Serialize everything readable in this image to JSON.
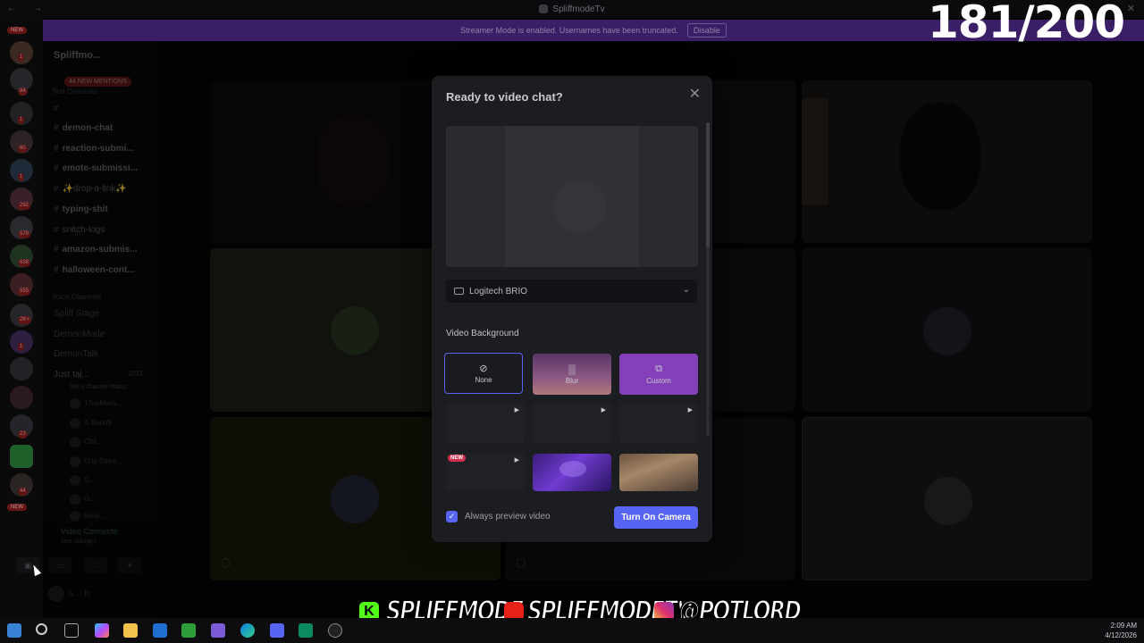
{
  "window": {
    "title": "SpliffmodeTv",
    "nav_glyph": "← →",
    "close_glyph": "✕"
  },
  "banner": {
    "text": "Streamer Mode is enabled. Usernames have been truncated.",
    "button": "Disable"
  },
  "counter": "181/200",
  "server_rail": {
    "new_top": "NEW",
    "new_bottom": "NEW",
    "badges": [
      "1",
      "94",
      "1",
      "60",
      "1",
      "292",
      "579",
      "638",
      "555",
      "2K+",
      "1",
      "23",
      "44"
    ]
  },
  "sidebar": {
    "server_name": "Spliffmo...",
    "mentions": "44 NEW MENTIONS",
    "text_category": "Text Channels",
    "channels": [
      "demon-chat",
      "reaction-submi...",
      "emote-submissi...",
      "✨drop-a-link✨",
      "typing-shit",
      "snitch-logs",
      "amazon-submis...",
      "halloween-cont..."
    ],
    "voice_category": "Voice Channels",
    "voice_channels": [
      "Spliff Stage",
      "DemonMode",
      "DemonTalk",
      "Just tal...",
      "Set a channel status"
    ],
    "voice_count": "2/33",
    "voice_users": [
      "1TooMany...",
      "A-Band$",
      "Chil...",
      "Crip Strea...",
      "G...",
      "G...",
      "boca..."
    ],
    "voice_panel": {
      "status": "Video Connecte",
      "sub": "Just talking / ..."
    },
    "user": {
      "name": "S...",
      "status": "In"
    }
  },
  "modal": {
    "title": "Ready to video chat?",
    "close_glyph": "✕",
    "camera": "Logitech BRIO",
    "background_heading": "Video Background",
    "options": [
      {
        "label": "None",
        "icon": "⊘"
      },
      {
        "label": "Blur",
        "icon": "▒"
      },
      {
        "label": "Custom",
        "icon": "⧉"
      }
    ],
    "new_tag": "NEW",
    "play_glyph": "▶",
    "always_preview_label": "Always preview video",
    "always_preview_checked": true,
    "check_glyph": "✓",
    "turn_on_label": "Turn On Camera"
  },
  "social": {
    "kick": "SPLIFFMODE",
    "youtube": "SPLIFFMODETV",
    "instagram": "@POTLORD"
  },
  "taskbar": {
    "time": "2:09 AM",
    "date": "4/12/2026"
  },
  "colors": {
    "accent": "#5865f2",
    "banner": "#3b1f66",
    "custom": "#8340b8",
    "new_tag": "#d32f4f"
  }
}
